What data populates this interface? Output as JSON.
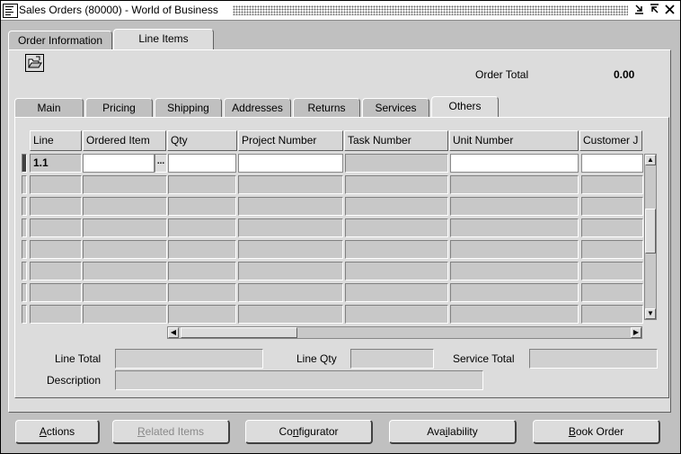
{
  "window": {
    "title": "Sales Orders (80000) - World of Business",
    "controls": [
      "minimize-icon",
      "maximize-icon",
      "close-icon"
    ]
  },
  "top_tabs": [
    {
      "label": "Order Information",
      "active": false
    },
    {
      "label": "Line Items",
      "active": true
    }
  ],
  "header": {
    "order_total_label": "Order Total",
    "order_total_value": "0.00",
    "open_icon": "folder-open-icon"
  },
  "sub_tabs": [
    {
      "label": "Main",
      "active": false
    },
    {
      "label": "Pricing",
      "active": false
    },
    {
      "label": "Shipping",
      "active": false
    },
    {
      "label": "Addresses",
      "active": false
    },
    {
      "label": "Returns",
      "active": false
    },
    {
      "label": "Services",
      "active": false
    },
    {
      "label": "Others",
      "active": true
    }
  ],
  "grid": {
    "columns": [
      "Line",
      "Ordered Item",
      "Qty",
      "Project Number",
      "Task Number",
      "Unit Number",
      "Customer J"
    ],
    "rows": [
      {
        "line": "1.1",
        "ordered_item": "",
        "qty": "",
        "project_number": "",
        "task_number": "",
        "unit_number": "",
        "customer_job": ""
      },
      {},
      {},
      {},
      {},
      {},
      {},
      {}
    ],
    "lov_button": "..."
  },
  "footer": {
    "line_total_label": "Line Total",
    "line_total_value": "",
    "line_qty_label": "Line Qty",
    "line_qty_value": "",
    "service_total_label": "Service Total",
    "service_total_value": "",
    "description_label": "Description",
    "description_value": ""
  },
  "actions": [
    {
      "label": "Actions",
      "mnemonic": "A",
      "enabled": true
    },
    {
      "label": "Related Items",
      "mnemonic": "R",
      "enabled": false
    },
    {
      "label": "Configurator",
      "mnemonic": "n",
      "enabled": true
    },
    {
      "label": "Availability",
      "mnemonic": "i",
      "enabled": true
    },
    {
      "label": "Book Order",
      "mnemonic": "B",
      "enabled": true
    }
  ]
}
